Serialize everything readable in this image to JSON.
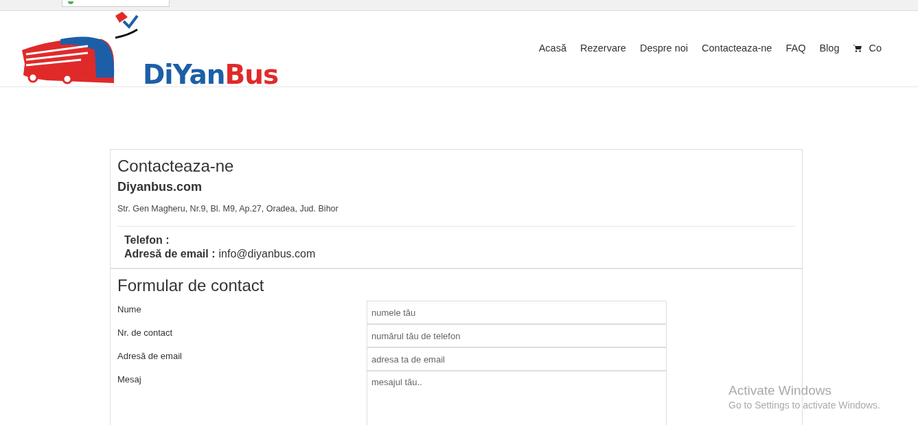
{
  "logo": {
    "part_1": "DiYan",
    "part_2": "Bus"
  },
  "nav": [
    {
      "label": "Acasă",
      "kind": "link"
    },
    {
      "label": "Rezervare",
      "kind": "link"
    },
    {
      "label": "Despre noi",
      "kind": "link"
    },
    {
      "label": "Contacteaza-ne",
      "kind": "link"
    },
    {
      "label": "FAQ",
      "kind": "link"
    },
    {
      "label": "Blog",
      "kind": "link"
    },
    {
      "label": "Co",
      "kind": "cart"
    }
  ],
  "contact": {
    "title": "Contacteaza-ne",
    "company": "Diyanbus.com",
    "address": "Str. Gen Magheru, Nr.9, Bl. M9, Ap.27, Oradea, Jud. Bihor",
    "phone_label": "Telefon :",
    "email_label": "Adresă de email :",
    "email": "info@diyanbus.com"
  },
  "form": {
    "title": "Formular de contact",
    "fields": [
      {
        "label": "Nume",
        "placeholder": "numele tău",
        "kind": "input"
      },
      {
        "label": "Nr. de contact",
        "placeholder": "numărul tău de telefon",
        "kind": "input"
      },
      {
        "label": "Adresă de email",
        "placeholder": "adresa ta de email",
        "kind": "input"
      },
      {
        "label": "Mesaj",
        "placeholder": "mesajul tău..",
        "kind": "textarea"
      }
    ]
  },
  "os_notice": {
    "title": "Activate Windows",
    "text": "Go to Settings to activate Windows."
  }
}
